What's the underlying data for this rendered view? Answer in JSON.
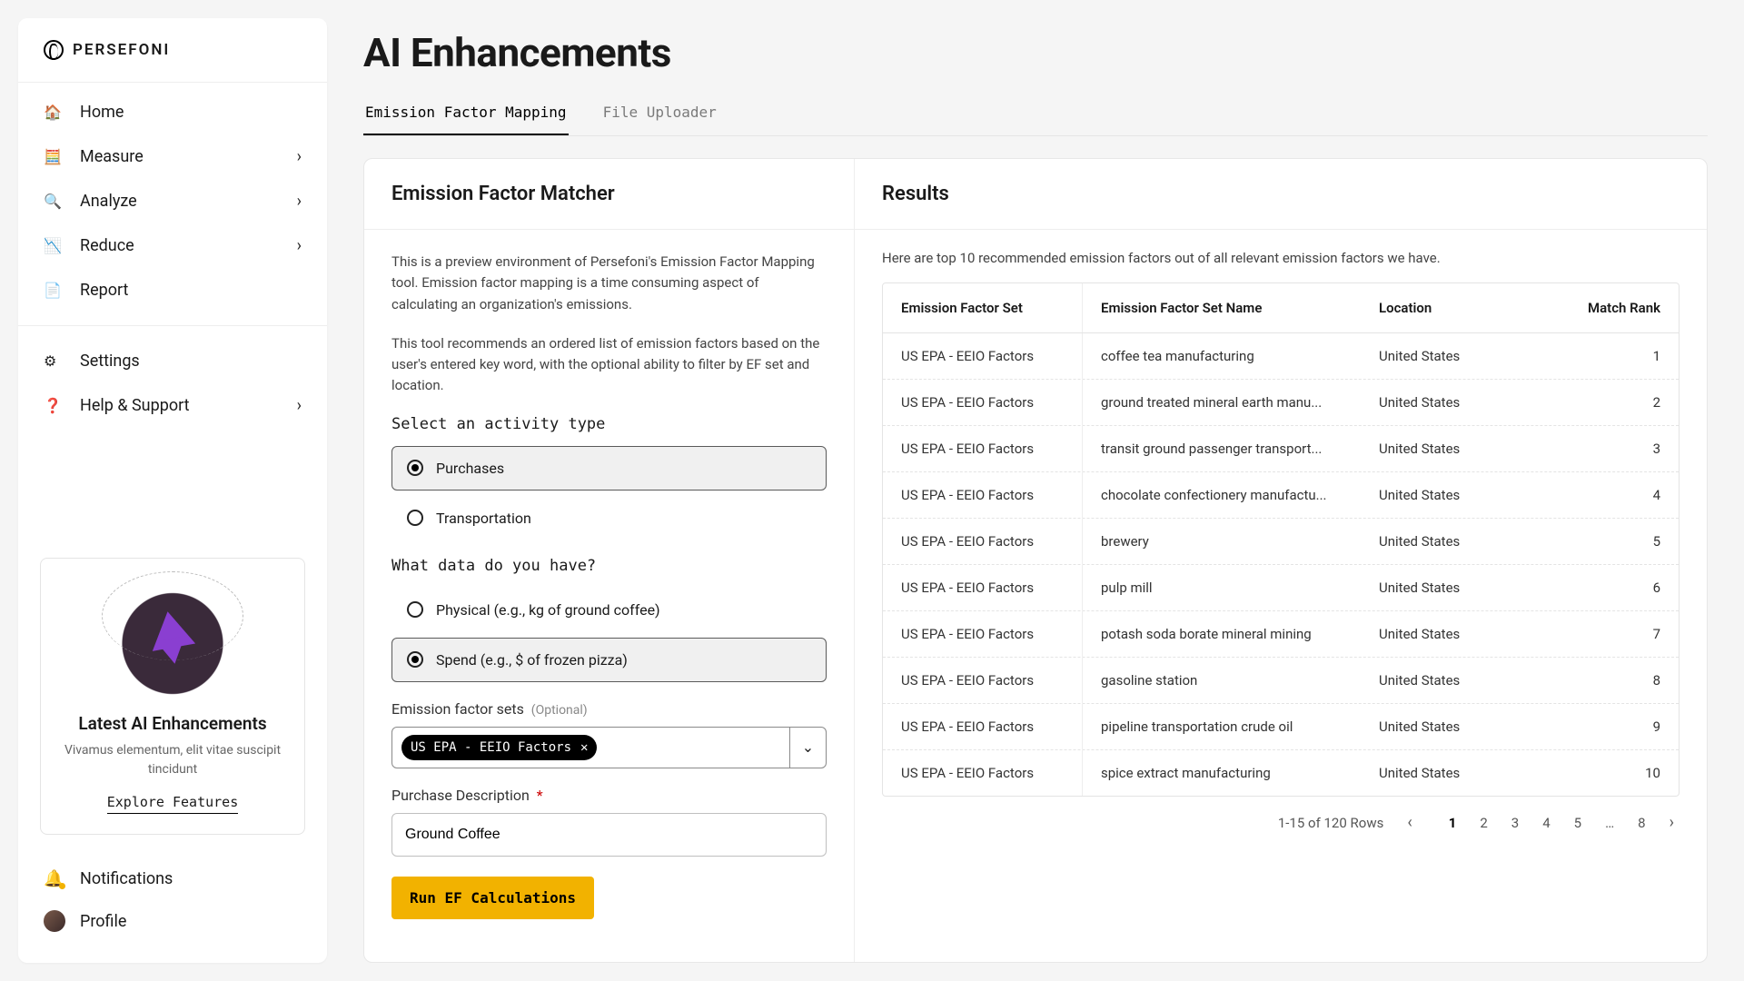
{
  "brand": "PERSEFONI",
  "nav": {
    "items": [
      {
        "icon": "home-icon",
        "glyph": "🏠",
        "label": "Home",
        "expandable": false
      },
      {
        "icon": "measure-icon",
        "glyph": "🧮",
        "label": "Measure",
        "expandable": true
      },
      {
        "icon": "analyze-icon",
        "glyph": "🔍",
        "label": "Analyze",
        "expandable": true
      },
      {
        "icon": "reduce-icon",
        "glyph": "📉",
        "label": "Reduce",
        "expandable": true
      },
      {
        "icon": "report-icon",
        "glyph": "📄",
        "label": "Report",
        "expandable": false
      }
    ],
    "footer_items": [
      {
        "icon": "gear-icon",
        "glyph": "⚙",
        "label": "Settings",
        "expandable": false
      },
      {
        "icon": "help-icon",
        "glyph": "❓",
        "label": "Help & Support",
        "expandable": true
      }
    ]
  },
  "promo": {
    "title": "Latest AI Enhancements",
    "subtitle": "Vivamus elementum, elit vitae suscipit tincidunt",
    "cta": "Explore Features"
  },
  "bottom": {
    "notifications": "Notifications",
    "profile": "Profile"
  },
  "page": {
    "title": "AI Enhancements"
  },
  "tabs": [
    {
      "label": "Emission Factor Mapping",
      "active": true
    },
    {
      "label": "File Uploader",
      "active": false
    }
  ],
  "matcher": {
    "heading": "Emission Factor Matcher",
    "intro1": "This is a preview environment of Persefoni's Emission Factor Mapping tool. Emission factor mapping is a time consuming aspect of calculating an organization's emissions.",
    "intro2": "This tool recommends an ordered list of emission factors based on the user's entered key word, with the optional ability to filter by EF set and location.",
    "activity_label": "Select an activity type",
    "activity_options": [
      {
        "label": "Purchases",
        "selected": true
      },
      {
        "label": "Transportation",
        "selected": false
      }
    ],
    "data_label": "What data do you have?",
    "data_options": [
      {
        "label": "Physical (e.g., kg of ground coffee)",
        "selected": false
      },
      {
        "label": "Spend (e.g., $ of frozen pizza)",
        "selected": true
      }
    ],
    "ef_sets_label": "Emission factor sets",
    "ef_sets_optional": "(Optional)",
    "ef_set_chip": "US EPA - EEIO Factors",
    "purchase_label": "Purchase Description",
    "purchase_value": "Ground Coffee",
    "run_label": "Run EF Calculations"
  },
  "results": {
    "heading": "Results",
    "intro": "Here are top 10 recommended emission factors out of all relevant emission factors we have.",
    "columns": [
      "Emission Factor Set",
      "Emission Factor Set Name",
      "Location",
      "Match Rank"
    ],
    "rows": [
      {
        "set": "US EPA - EEIO Factors",
        "name": "coffee tea manufacturing",
        "loc": "United States",
        "rank": 1
      },
      {
        "set": "US EPA - EEIO Factors",
        "name": "ground treated mineral earth manu...",
        "loc": "United States",
        "rank": 2
      },
      {
        "set": "US EPA - EEIO Factors",
        "name": "transit ground passenger transport...",
        "loc": "United States",
        "rank": 3
      },
      {
        "set": "US EPA - EEIO Factors",
        "name": "chocolate confectionery manufactu...",
        "loc": "United States",
        "rank": 4
      },
      {
        "set": "US EPA - EEIO Factors",
        "name": "brewery",
        "loc": "United States",
        "rank": 5
      },
      {
        "set": "US EPA - EEIO Factors",
        "name": "pulp mill",
        "loc": "United States",
        "rank": 6
      },
      {
        "set": "US EPA - EEIO Factors",
        "name": "potash soda borate mineral mining",
        "loc": "United States",
        "rank": 7
      },
      {
        "set": "US EPA - EEIO Factors",
        "name": "gasoline station",
        "loc": "United States",
        "rank": 8
      },
      {
        "set": "US EPA - EEIO Factors",
        "name": "pipeline transportation crude oil",
        "loc": "United States",
        "rank": 9
      },
      {
        "set": "US EPA - EEIO Factors",
        "name": "spice extract manufacturing",
        "loc": "United States",
        "rank": 10
      }
    ],
    "pagination": {
      "range": "1-15 of 120 Rows",
      "pages": [
        "1",
        "2",
        "3",
        "4",
        "5",
        "…",
        "8"
      ],
      "current": "1"
    }
  }
}
